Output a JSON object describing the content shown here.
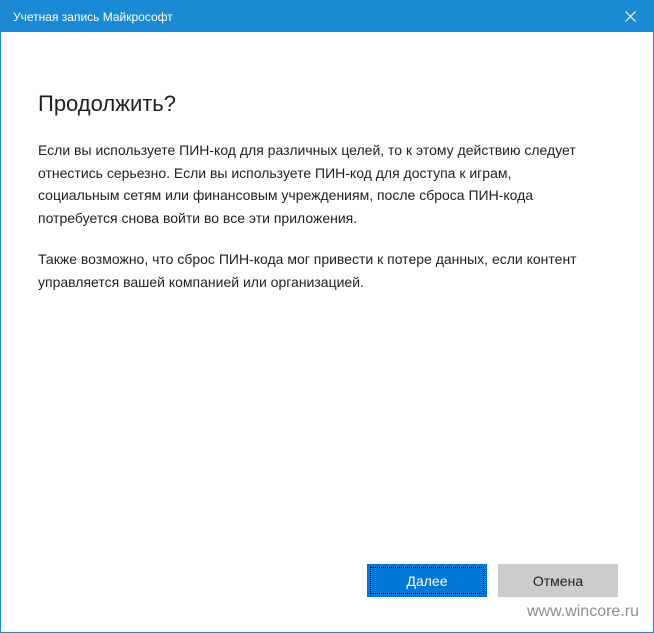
{
  "window": {
    "title": "Учетная запись Майкрософт",
    "close_icon": "close-icon",
    "accent_color": "#1a8ad4"
  },
  "dialog": {
    "heading": "Продолжить?",
    "paragraph1": "Если вы используете ПИН-код для различных целей, то к этому действию следует\nотнестись серьезно. Если вы используете ПИН-код для доступа к играм,\nсоциальным сетям или финансовым учреждениям, после сброса ПИН-кода\nпотребуется снова войти во все эти приложения.",
    "paragraph2": "Также возможно, что сброс ПИН-кода мог привести к потере данных, если контент\nуправляется вашей компанией или организацией."
  },
  "buttons": {
    "continue_label": "Далее",
    "cancel_label": "Отмена",
    "primary_color": "#0078d7",
    "secondary_color": "#cccccc"
  },
  "watermark": "www.wincore.ru"
}
